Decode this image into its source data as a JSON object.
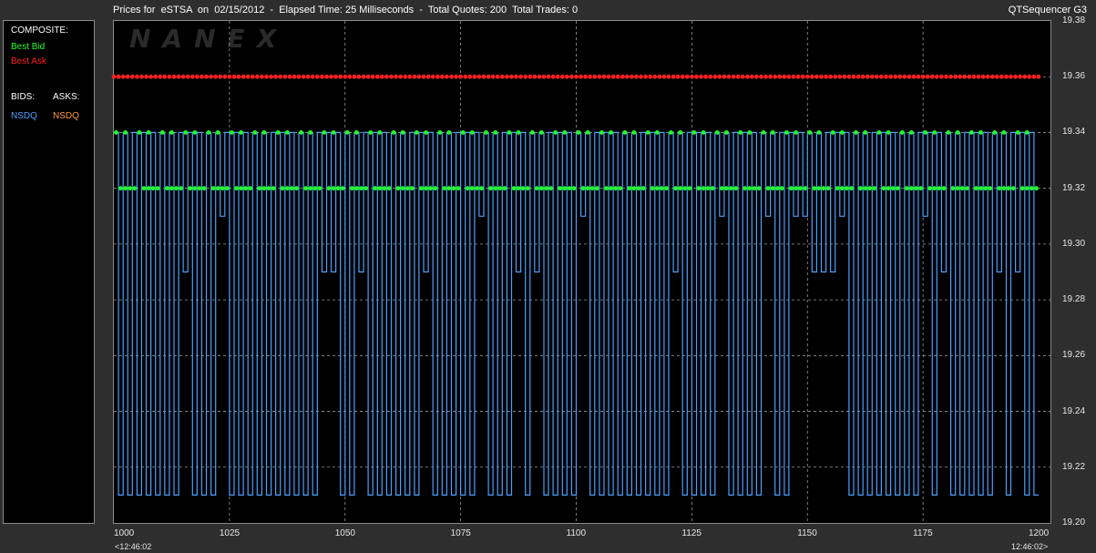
{
  "header": {
    "title": "Prices for  eSTSA  on  02/15/2012  -  Elapsed Time: 25 Milliseconds  -  Total Quotes: 200  Total Trades: 0",
    "app_name": "QTSequencer G3"
  },
  "watermark": "NANEX",
  "legend": {
    "composite_label": "COMPOSITE:",
    "best_bid_label": "Best Bid",
    "best_ask_label": "Best Ask",
    "bids_label": "BIDS:",
    "asks_label": "ASKS:",
    "bid_exchange": "NSDQ",
    "ask_exchange": "NSDQ",
    "colors": {
      "best_bid": "#22ff22",
      "best_ask": "#ff2020",
      "bid_exchange": "#4aa0ff",
      "ask_exchange": "#ff9a40"
    }
  },
  "x_sub_labels": {
    "start": "<12:46:02",
    "end": "12:46:02>"
  },
  "chart_data": {
    "type": "line",
    "title": "",
    "xlabel": "",
    "ylabel": "",
    "xlim": [
      1000,
      1200
    ],
    "ylim": [
      19.2,
      19.38
    ],
    "x_ticks": [
      "1000",
      "1025",
      "1050",
      "1075",
      "1100",
      "1125",
      "1150",
      "1175",
      "1200"
    ],
    "y_ticks": [
      "19.38",
      "19.36",
      "19.34",
      "19.32",
      "19.30",
      "19.28",
      "19.26",
      "19.24",
      "19.22",
      "19.20"
    ],
    "grid": true,
    "series": [
      {
        "name": "Best Ask",
        "color": "#ff2020",
        "style": "markers",
        "value": 19.36
      },
      {
        "name": "Best Bid",
        "color": "#22ff22",
        "style": "markers",
        "levels": [
          19.34,
          19.32
        ]
      },
      {
        "name": "NSDQ",
        "color": "#4aa0ff",
        "style": "step",
        "range": [
          19.21,
          19.34
        ],
        "intermediate_levels": [
          19.31,
          19.29
        ]
      }
    ]
  }
}
